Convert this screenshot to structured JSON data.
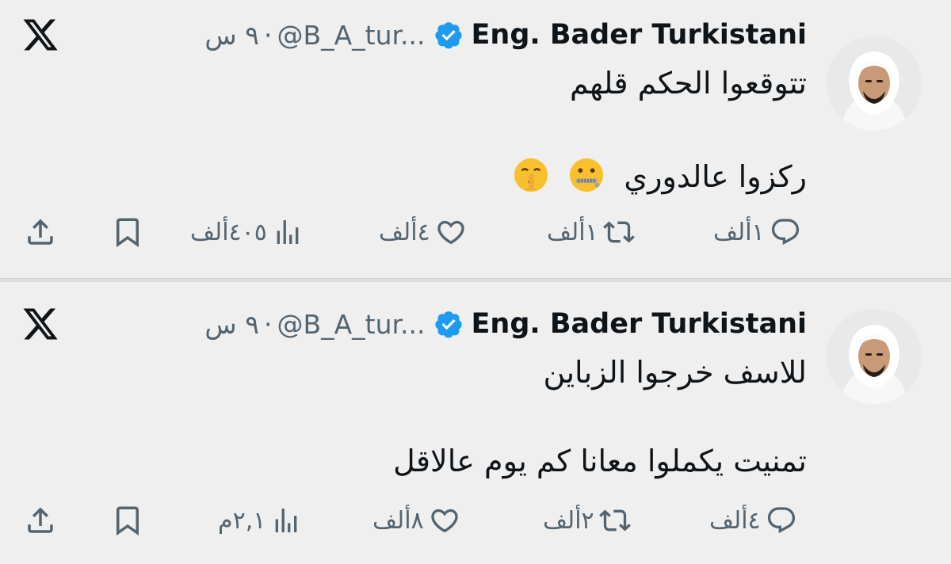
{
  "colors": {
    "background": "#efefef",
    "text": "#0f1419",
    "muted": "#536471",
    "verified_badge": "#1d9bf0"
  },
  "tweets": [
    {
      "author": {
        "name": "Eng. Bader Turkistani",
        "handle": "@B_A_tur...",
        "verified_icon": "verified-badge-icon"
      },
      "separator": "·",
      "time": "٩ س",
      "lines": [
        "تتوقعوا الحكم قلهم",
        "ركزوا عالدوري"
      ],
      "emojis": [
        "zipper-mouth-face-icon",
        "shushing-face-icon"
      ],
      "stats": {
        "replies": "١ألف",
        "reposts": "١ألف",
        "likes": "٤ألف",
        "views": "٤٠٥ألف"
      }
    },
    {
      "author": {
        "name": "Eng. Bader Turkistani",
        "handle": "@B_A_tur...",
        "verified_icon": "verified-badge-icon"
      },
      "separator": "·",
      "time": "٩ س",
      "lines": [
        "للاسف خرجوا الزباين",
        "تمنيت يكملوا معانا كم يوم عالاقل"
      ],
      "emojis": [],
      "stats": {
        "replies": "٤ألف",
        "reposts": "٢ألف",
        "likes": "٨ألف",
        "views": "٢,١م"
      }
    }
  ]
}
